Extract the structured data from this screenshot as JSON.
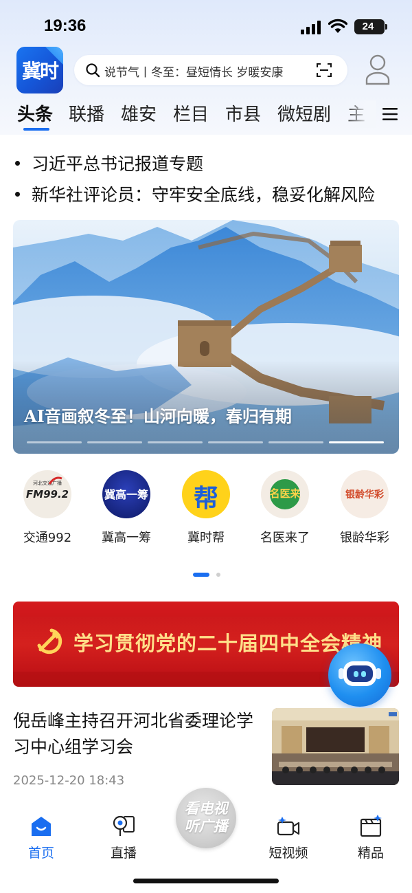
{
  "status_bar": {
    "time": "19:36",
    "battery": "24"
  },
  "header": {
    "logo_text": "冀时",
    "search_text": "说节气丨冬至：昼短情长 岁暖安康",
    "search_icon": "search-icon",
    "scan_icon": "scan-icon",
    "user_icon": "user-icon"
  },
  "tabs": [
    {
      "label": "头条"
    },
    {
      "label": "联播"
    },
    {
      "label": "雄安"
    },
    {
      "label": "栏目"
    },
    {
      "label": "市县"
    },
    {
      "label": "微短剧"
    },
    {
      "label": "主"
    }
  ],
  "headlines": [
    {
      "text": "习近平总书记报道专题"
    },
    {
      "text": "新华社评论员：守牢安全底线，稳妥化解风险"
    }
  ],
  "banner": {
    "title": "AI音画叙冬至！山河向暖，春归有期",
    "slide_count": 6,
    "active_slide": 6
  },
  "services": [
    {
      "label": "交通992",
      "logo_text": "FM99.2",
      "logo_sub": "河北交通广播"
    },
    {
      "label": "冀高一筹",
      "logo_text": "冀高一筹"
    },
    {
      "label": "冀时帮",
      "logo_text": "帮"
    },
    {
      "label": "名医来了",
      "logo_text": "名医来"
    },
    {
      "label": "银龄华彩",
      "logo_text": "银龄华彩"
    }
  ],
  "services_page": {
    "current": 1,
    "total": 2
  },
  "red_banner": {
    "text": "学习贯彻党的二十届四中全会精神"
  },
  "news": [
    {
      "title": "倪岳峰主持召开河北省委理论学习中心组学习会",
      "date": "2025-12-20  18:43"
    }
  ],
  "bottom_nav": {
    "items": [
      {
        "label": "首页",
        "icon": "home-icon",
        "active": true
      },
      {
        "label": "直播",
        "icon": "live-icon",
        "active": false
      },
      {
        "label": "短视频",
        "icon": "short-video-icon",
        "active": false
      },
      {
        "label": "精品",
        "icon": "premium-icon",
        "active": false
      }
    ],
    "center_line1": "看电视",
    "center_line2": "听广播"
  },
  "colors": {
    "accent": "#1a6ef0",
    "red_banner": "#c01216",
    "gold_text": "#ffdf8a"
  }
}
